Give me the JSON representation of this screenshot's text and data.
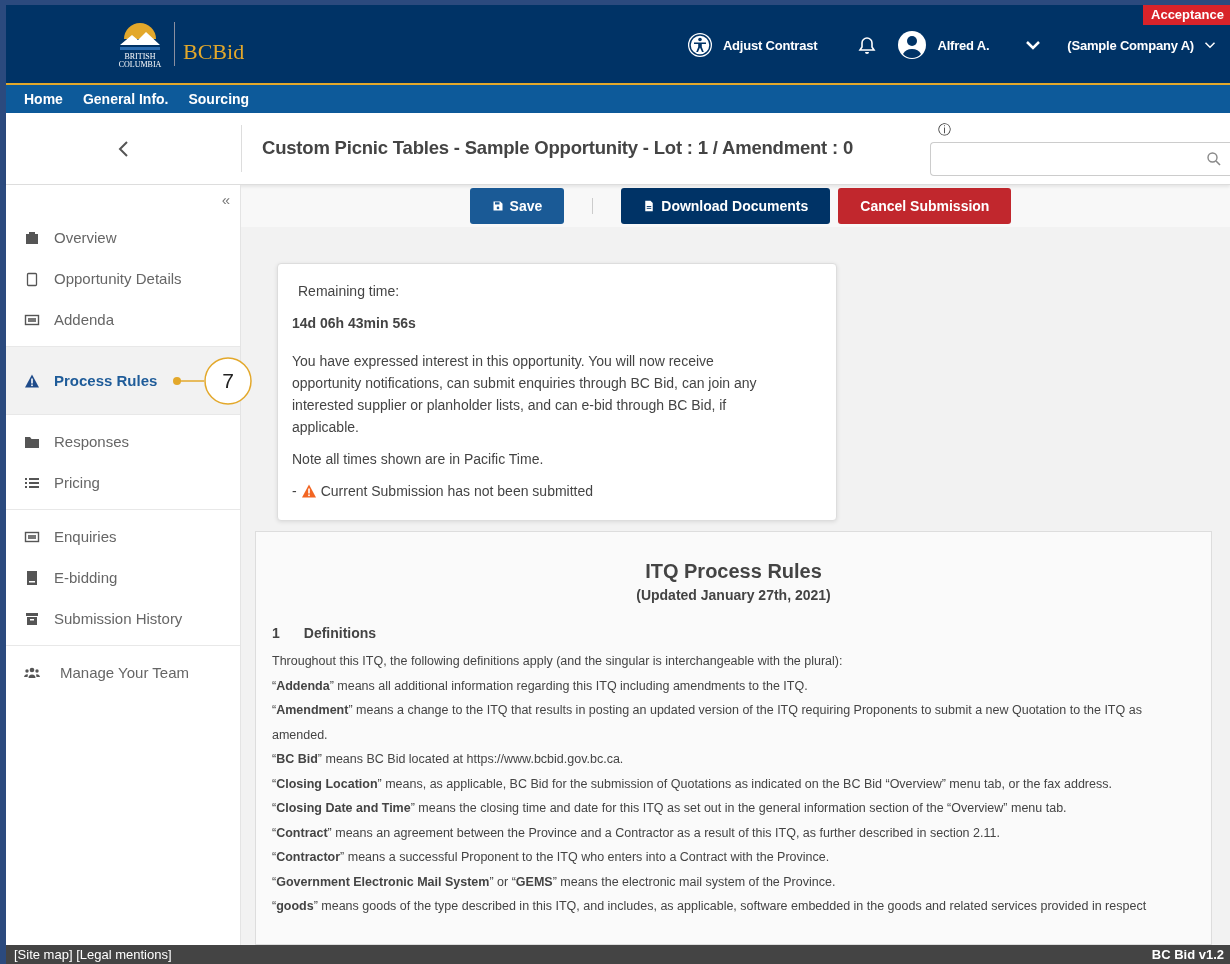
{
  "header": {
    "logo_small": "BRITISH COLUMBIA",
    "logo_brand": "BCBid",
    "contrast": "Adjust Contrast",
    "user": "Alfred A.",
    "company": "(Sample Company A)",
    "environment": "Acceptance"
  },
  "nav": [
    {
      "label": "Home"
    },
    {
      "label": "General Info."
    },
    {
      "label": "Sourcing"
    }
  ],
  "title": "Custom Picnic Tables - Sample Opportunity - Lot : 1 / Amendment : 0",
  "search": {
    "info": "ⓘ"
  },
  "collapse": "«",
  "sidebar": [
    [
      {
        "label": "Overview",
        "selected": false
      },
      {
        "label": "Opportunity Details",
        "selected": false
      },
      {
        "label": "Addenda",
        "selected": false
      }
    ],
    [
      {
        "label": "Process Rules",
        "selected": true,
        "callout": "7"
      }
    ],
    [
      {
        "label": "Responses",
        "selected": false
      },
      {
        "label": "Pricing",
        "selected": false
      }
    ],
    [
      {
        "label": "Enquiries",
        "selected": false
      },
      {
        "label": "E-bidding",
        "selected": false
      },
      {
        "label": "Submission History",
        "selected": false
      }
    ],
    [
      {
        "label": "Manage Your Team",
        "selected": false
      }
    ]
  ],
  "actions": [
    {
      "label": "Save",
      "kind": "save"
    },
    {
      "label": "Download Documents",
      "kind": "download"
    },
    {
      "label": "Cancel Submission",
      "kind": "cancel"
    }
  ],
  "info_card": {
    "remaining_label": "Remaining time:",
    "remaining_value": "14d 06h 43min 56s",
    "message": "You have expressed interest in this opportunity.  You will now receive opportunity notifications, can submit enquiries through BC Bid, can join any interested supplier or planholder lists, and can e-bid through BC Bid, if applicable.",
    "note": "Note all times shown are in Pacific Time.",
    "warning_prefix": "-",
    "warning": "Current Submission has not been submitted"
  },
  "rules": {
    "title": "ITQ Process Rules",
    "subtitle": "(Updated January 27th, 2021)",
    "section_number": "1",
    "section_title": "Definitions",
    "paragraphs": [
      "Throughout this ITQ, the following definitions apply (and the singular is interchangeable with the plural):",
      "“**Addenda**” means all additional information regarding this ITQ including amendments to the ITQ.",
      "“**Amendment**” means a change to the ITQ that results in posting an updated version of the ITQ requiring Proponents to submit a new Quotation to the ITQ as amended.",
      "“**BC Bid**” means BC Bid located at https://www.bcbid.gov.bc.ca.",
      "“**Closing Location**” means, as applicable, BC Bid for the submission of Quotations as indicated on the BC Bid “Overview” menu tab, or the fax address.",
      "“**Closing Date and Time**” means the closing time and date for this ITQ as set out in the general information section of the “Overview” menu tab.",
      "“**Contract**” means an agreement between the Province and a Contractor as a result of this ITQ, as further described in section 2.11.",
      "“**Contractor**” means a successful Proponent to the ITQ who enters into a Contract with the Province.",
      "“**Government Electronic Mail System**” or “**GEMS**” means the electronic mail system of the Province.",
      "“**goods**” means goods of the type described in this ITQ, and includes, as applicable, software embedded in the goods and related services provided in respect"
    ]
  },
  "footer": {
    "links": "[Site map] [Legal mentions]",
    "version": "BC Bid v1.2"
  }
}
